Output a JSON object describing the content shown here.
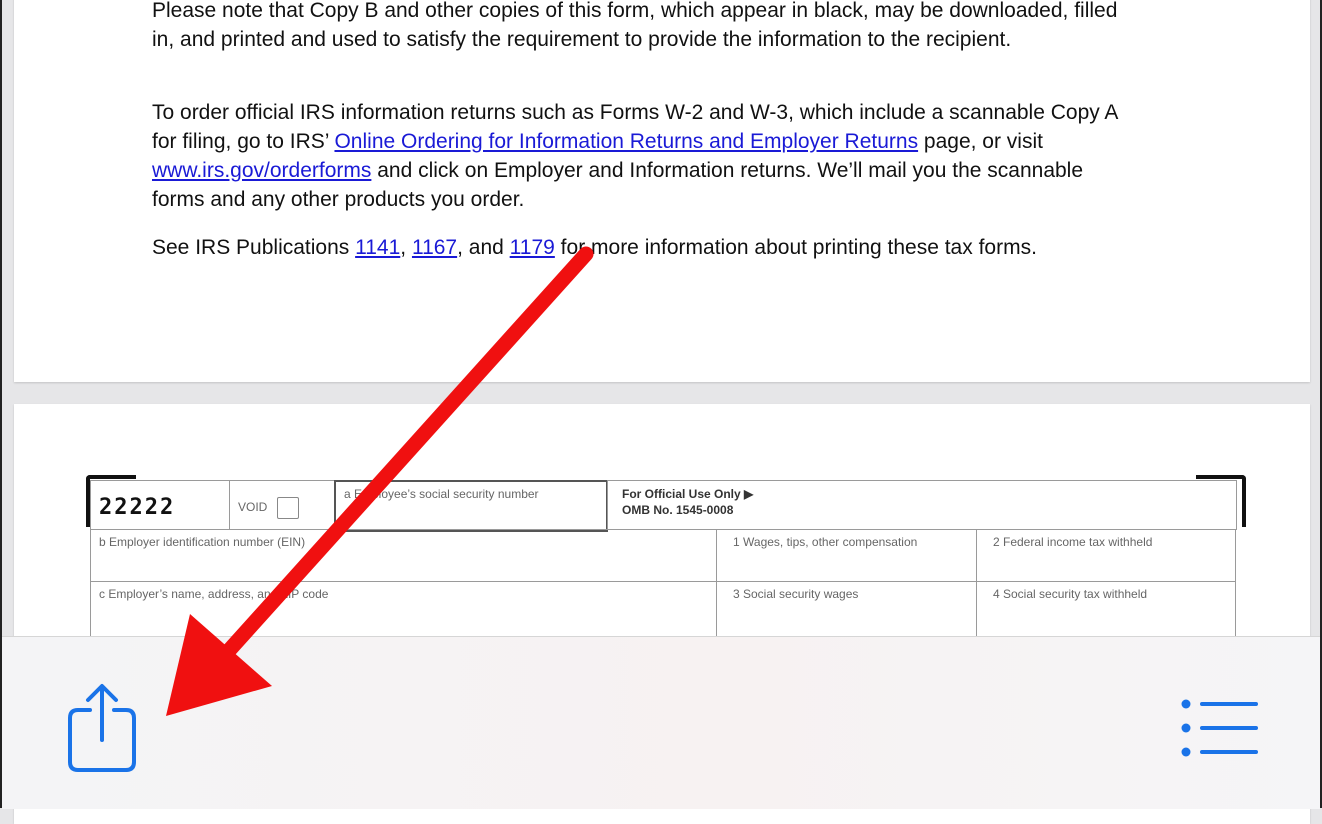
{
  "document": {
    "para1": {
      "text": "Please note that Copy B and other copies of this form, which appear in black, may be downloaded, filled in, and printed and used to satisfy the requirement to provide the information to the recipient."
    },
    "para2": {
      "before_link1": "To order official IRS information returns such as Forms W-2 and W-3, which include a scannable Copy A for filing, go to IRS’ ",
      "link1": "Online Ordering for Information Returns and Employer Returns",
      "between": " page, or visit ",
      "link2": "www.irs.gov/orderforms",
      "after": " and click on Employer and Information returns. We’ll mail you the scannable forms and any other products you order."
    },
    "para3": {
      "before": "See IRS Publications ",
      "link1": "1141",
      "sep1": ", ",
      "link2": "1167",
      "sep2": ", and ",
      "link3": "1179",
      "after": " for more information about printing these tax forms."
    }
  },
  "form": {
    "code": "22222",
    "void_label": "VOID",
    "ssn_label": "a  Employee’s social security number",
    "official_line1": "For Official Use Only ▶",
    "official_line2": "OMB No. 1545-0008",
    "box_b": "b  Employer identification number (EIN)",
    "box_1": "1   Wages, tips, other compensation",
    "box_2": "2   Federal income tax withheld",
    "box_c": "c  Employer’s name, address, and ZIP code",
    "box_3": "3   Social security wages",
    "box_4": "4   Social security tax withheld"
  },
  "toolbar": {
    "share_icon": "share-icon",
    "list_icon": "list-icon"
  },
  "colors": {
    "link": "#1a1ad6",
    "ios_blue": "#1a73e8",
    "arrow_red": "#f01010"
  }
}
